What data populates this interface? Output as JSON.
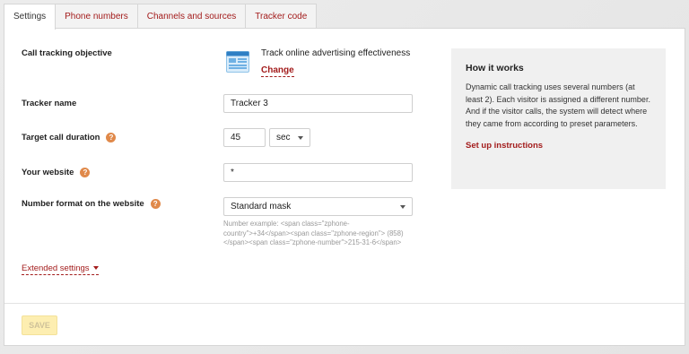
{
  "tabs": [
    {
      "label": "Settings",
      "active": true
    },
    {
      "label": "Phone numbers",
      "active": false
    },
    {
      "label": "Channels and sources",
      "active": false
    },
    {
      "label": "Tracker code",
      "active": false
    }
  ],
  "form": {
    "objective": {
      "label": "Call tracking objective",
      "value": "Track online advertising effectiveness",
      "change_label": "Change",
      "icon": "browser-window-icon"
    },
    "tracker_name": {
      "label": "Tracker name",
      "value": "Tracker 3"
    },
    "target_duration": {
      "label": "Target call duration",
      "value": "45",
      "unit": "sec"
    },
    "website": {
      "label": "Your website",
      "value": "*"
    },
    "number_format": {
      "label": "Number format on the website",
      "value": "Standard mask",
      "hint": "Number example: <span class=\"zphone-country\">+34</span><span class=\"zphone-region\"> (858)</span><span class=\"zphone-number\">215-31-6</span>"
    },
    "extended_settings_label": "Extended settings"
  },
  "how_it_works": {
    "title": "How it works",
    "text_1": "Dynamic call tracking uses several numbers (at least 2). Each visitor is assigned a different number.",
    "text_2": "And if the visitor calls, the system will detect where they came from according to preset parameters.",
    "link": "Set up instructions"
  },
  "footer": {
    "save_label": "SAVE",
    "save_enabled": false
  },
  "colors": {
    "accent": "#a31c1c",
    "help_icon": "#e0894a",
    "save_disabled_bg": "#fdeeb1"
  },
  "help_icon_glyph": "?"
}
